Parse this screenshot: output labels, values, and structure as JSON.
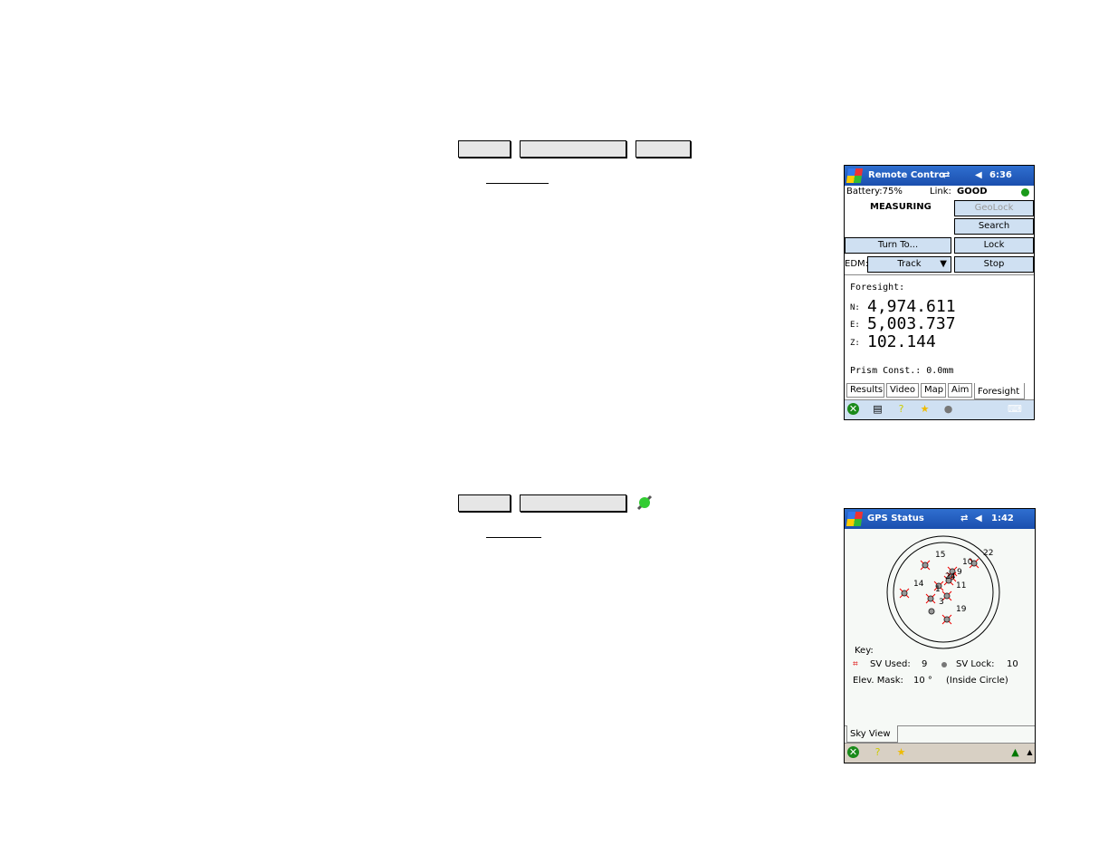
{
  "remote_control": {
    "title": "Remote Contro",
    "time": "6:36",
    "battery": "Battery:75%",
    "link_label": "Link:",
    "link_value": "GOOD",
    "status": "MEASURING",
    "buttons": {
      "geolock": "GeoLock",
      "search": "Search",
      "turn_to": "Turn To...",
      "lock": "Lock",
      "stop": "Stop"
    },
    "edm_label": "EDM:",
    "edm_value": "Track",
    "foresight_label": "Foresight:",
    "n_label": "N:",
    "n_value": "4,974.611",
    "e_label": "E:",
    "e_value": "5,003.737",
    "z_label": "Z:",
    "z_value": "102.144",
    "prism": "Prism Const.: 0.0mm",
    "tabs": [
      "Results",
      "Video",
      "Map",
      "Aim",
      "Foresight"
    ],
    "colors": {
      "title_bar": "#1b4fae",
      "button": "#cfe0f2",
      "link_ok": "#1a9a1a"
    }
  },
  "gps_status": {
    "title": "GPS Status",
    "time": "1:42",
    "satellites": [
      "15",
      "22",
      "10",
      "9",
      "24",
      "1",
      "11",
      "14",
      "3",
      "19"
    ],
    "key_label": "Key:",
    "sv_used_label": "SV Used:",
    "sv_used": "9",
    "sv_lock_label": "SV Lock:",
    "sv_lock": "10",
    "elev_label": "Elev. Mask:",
    "elev_value": "10 °",
    "elev_note": "(Inside Circle)",
    "tab": "Sky View"
  }
}
